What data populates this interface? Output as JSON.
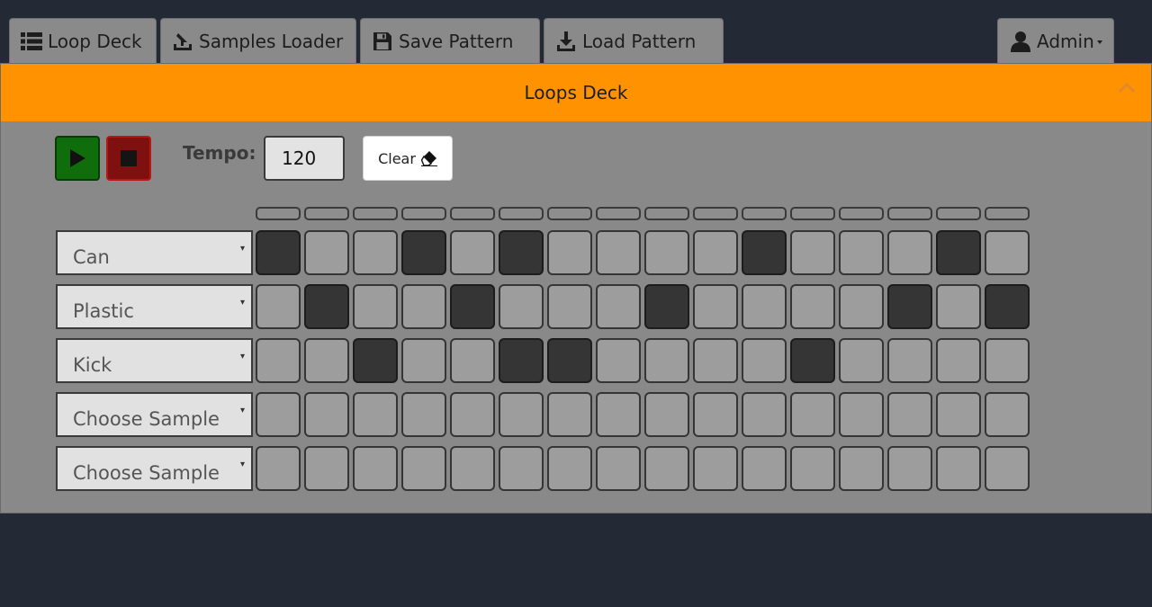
{
  "nav": {
    "tabs": [
      {
        "label": "Loop Deck",
        "icon": "list-icon"
      },
      {
        "label": "Samples Loader",
        "icon": "upload-icon"
      },
      {
        "label": "Save Pattern",
        "icon": "floppy-disk-icon"
      },
      {
        "label": "Load Pattern",
        "icon": "download-icon"
      }
    ],
    "user": {
      "label": "Admin",
      "icon": "user-icon"
    }
  },
  "panel": {
    "title": "Loops Deck",
    "collapse_icon": "chevron-up-icon"
  },
  "controls": {
    "play_icon": "play-icon",
    "stop_icon": "stop-icon",
    "tempo_label": "Tempo:",
    "tempo_value": "120",
    "clear_label": "Clear",
    "clear_icon": "eraser-icon"
  },
  "sequencer": {
    "steps": 16,
    "rows": [
      {
        "sample": "Can",
        "pattern": [
          1,
          0,
          0,
          1,
          0,
          1,
          0,
          0,
          0,
          0,
          1,
          0,
          0,
          0,
          1,
          0
        ]
      },
      {
        "sample": "Plastic",
        "pattern": [
          0,
          1,
          0,
          0,
          1,
          0,
          0,
          0,
          1,
          0,
          0,
          0,
          0,
          1,
          0,
          1
        ]
      },
      {
        "sample": "Kick",
        "pattern": [
          0,
          0,
          1,
          0,
          0,
          1,
          1,
          0,
          0,
          0,
          0,
          1,
          0,
          0,
          0,
          0
        ]
      },
      {
        "sample": "Choose Sample",
        "pattern": [
          0,
          0,
          0,
          0,
          0,
          0,
          0,
          0,
          0,
          0,
          0,
          0,
          0,
          0,
          0,
          0
        ]
      },
      {
        "sample": "Choose Sample",
        "pattern": [
          0,
          0,
          0,
          0,
          0,
          0,
          0,
          0,
          0,
          0,
          0,
          0,
          0,
          0,
          0,
          0
        ]
      }
    ]
  },
  "colors": {
    "background": "#232a35",
    "panel": "#898989",
    "header_accent": "#ff9200",
    "play": "#0f6e0b",
    "stop": "#7e1010",
    "cell_on": "#353535",
    "cell_off": "#9d9d9d"
  }
}
